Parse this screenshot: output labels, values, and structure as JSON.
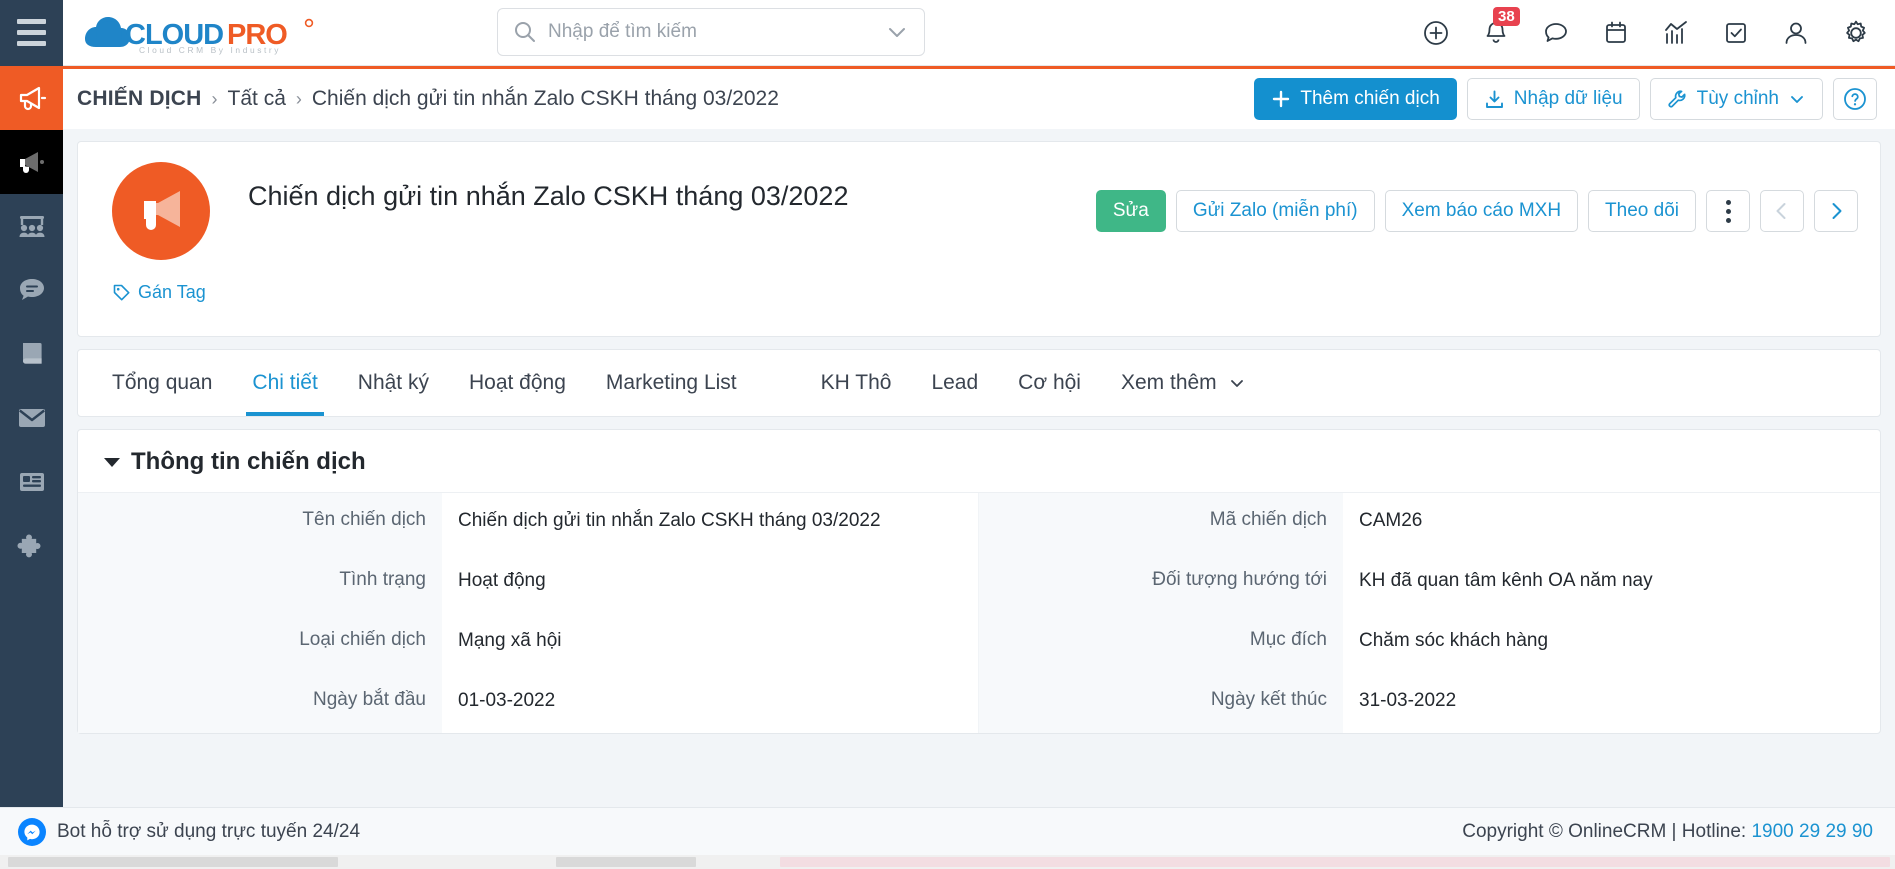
{
  "brand": {
    "name_cloud": "CLOUD",
    "name_pro": "PRO",
    "tagline": "Cloud CRM By Industry",
    "accent_orange": "#ef5b25",
    "accent_blue": "#1b93d1",
    "sidebar_bg": "#2d4156"
  },
  "topbar": {
    "menu_icon": "hamburger-icon",
    "search": {
      "placeholder": "Nhập để tìm kiếm",
      "value": "",
      "search_icon": "search-icon",
      "dropdown_icon": "chevron-down-icon"
    },
    "icons": [
      {
        "name": "add-circle-icon",
        "label": "Thêm"
      },
      {
        "name": "bell-icon",
        "label": "Thông báo",
        "badge": "38"
      },
      {
        "name": "chat-bubble-icon",
        "label": "Tin nhắn"
      },
      {
        "name": "calendar-icon",
        "label": "Lịch"
      },
      {
        "name": "chart-icon",
        "label": "Báo cáo"
      },
      {
        "name": "checkbox-icon",
        "label": "Công việc"
      },
      {
        "name": "user-icon",
        "label": "Tài khoản"
      },
      {
        "name": "gear-icon",
        "label": "Cài đặt"
      }
    ]
  },
  "sidebar": {
    "items": [
      {
        "name": "sidebar-item-campaign",
        "icon": "megaphone-icon",
        "active": true
      },
      {
        "name": "sidebar-item-campaign-alt",
        "icon": "megaphone-icon",
        "active": false,
        "dark_tile": true
      },
      {
        "name": "sidebar-item-customers",
        "icon": "users-group-icon",
        "active": false
      },
      {
        "name": "sidebar-item-chat",
        "icon": "chat-bubble-icon",
        "active": false
      },
      {
        "name": "sidebar-item-catalog",
        "icon": "book-icon",
        "active": false
      },
      {
        "name": "sidebar-item-email",
        "icon": "envelope-icon",
        "active": false
      },
      {
        "name": "sidebar-item-news",
        "icon": "article-icon",
        "active": false
      },
      {
        "name": "sidebar-item-addons",
        "icon": "puzzle-icon",
        "active": false
      }
    ]
  },
  "breadcrumb": {
    "root": "CHIẾN DỊCH",
    "sep": "›",
    "mid": "Tất cả",
    "leaf": "Chiến dịch gửi tin nhắn Zalo CSKH tháng 03/2022"
  },
  "page_actions": {
    "add_label": "Thêm chiến dịch",
    "add_icon": "plus-icon",
    "import_label": "Nhập dữ liệu",
    "import_icon": "download-icon",
    "customize_label": "Tùy chỉnh",
    "customize_icon": "wrench-icon",
    "customize_chevron": "chevron-down-icon",
    "help_icon": "question-circle-icon"
  },
  "record": {
    "avatar_icon": "megaphone-icon",
    "title": "Chiến dịch gửi tin nhắn Zalo CSKH tháng 03/2022",
    "tag_label": "Gán Tag",
    "tag_icon": "tag-icon",
    "actions": [
      {
        "name": "edit-button",
        "label": "Sửa",
        "style": "green"
      },
      {
        "name": "send-zalo-button",
        "label": "Gửi Zalo (miễn phí)",
        "style": "outline"
      },
      {
        "name": "view-social-report-button",
        "label": "Xem báo cáo MXH",
        "style": "outline"
      },
      {
        "name": "follow-button",
        "label": "Theo dõi",
        "style": "outline"
      }
    ],
    "more_icon": "kebab-menu-icon",
    "prev_icon": "chevron-left-icon",
    "next_icon": "chevron-right-icon"
  },
  "tabs": [
    {
      "name": "tab-tong-quan",
      "label": "Tổng quan",
      "active": false
    },
    {
      "name": "tab-chi-tiet",
      "label": "Chi tiết",
      "active": true
    },
    {
      "name": "tab-nhat-ky",
      "label": "Nhật ký",
      "active": false
    },
    {
      "name": "tab-hoat-dong",
      "label": "Hoạt động",
      "active": false
    },
    {
      "name": "tab-marketing-list",
      "label": "Marketing List",
      "active": false
    },
    {
      "name": "tab-kh-tho",
      "label": "KH Thô",
      "active": false,
      "gap": true
    },
    {
      "name": "tab-lead",
      "label": "Lead",
      "active": false
    },
    {
      "name": "tab-co-hoi",
      "label": "Cơ hội",
      "active": false
    },
    {
      "name": "tab-xem-them",
      "label": "Xem thêm",
      "active": false,
      "chevron": "chevron-down-icon"
    }
  ],
  "detail": {
    "section_title": "Thông tin chiến dịch",
    "collapse_icon": "caret-down-icon",
    "left_fields": [
      {
        "label": "Tên chiến dịch",
        "value": "Chiến dịch gửi tin nhắn Zalo CSKH tháng 03/2022"
      },
      {
        "label": "Tình trạng",
        "value": "Hoạt động"
      },
      {
        "label": "Loại chiến dịch",
        "value": "Mạng xã hội"
      },
      {
        "label": "Ngày bắt đầu",
        "value": "01-03-2022"
      }
    ],
    "right_fields": [
      {
        "label": "Mã chiến dịch",
        "value": "CAM26"
      },
      {
        "label": "Đối tượng hướng tới",
        "value": "KH đã quan tâm kênh OA năm nay"
      },
      {
        "label": "Mục đích",
        "value": "Chăm sóc khách hàng"
      },
      {
        "label": "Ngày kết thúc",
        "value": "31-03-2022"
      }
    ]
  },
  "footer": {
    "bot_icon": "messenger-icon",
    "bot_text": "Bot hỗ trợ sử dụng trực tuyến 24/24",
    "copyright": "Copyright © OnlineCRM | Hotline: ",
    "hotline": "1900 29 29 90"
  }
}
